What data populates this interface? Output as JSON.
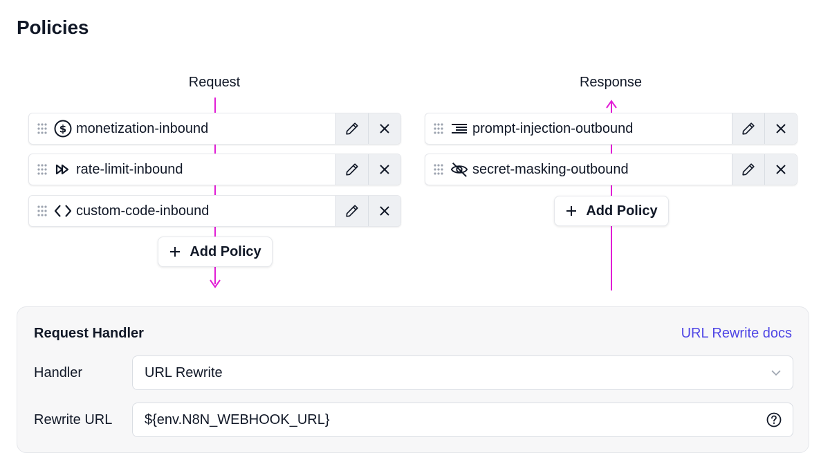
{
  "page": {
    "title": "Policies"
  },
  "request": {
    "label": "Request",
    "policies": [
      {
        "name": "monetization-inbound",
        "icon": "dollar-circle-icon"
      },
      {
        "name": "rate-limit-inbound",
        "icon": "fast-forward-icon"
      },
      {
        "name": "custom-code-inbound",
        "icon": "code-brackets-icon"
      }
    ],
    "add_label": "Add Policy"
  },
  "response": {
    "label": "Response",
    "policies": [
      {
        "name": "prompt-injection-outbound",
        "icon": "text-align-icon"
      },
      {
        "name": "secret-masking-outbound",
        "icon": "eye-off-icon"
      }
    ],
    "add_label": "Add Policy"
  },
  "handler": {
    "title": "Request Handler",
    "docs_link": "URL Rewrite docs",
    "handler_label": "Handler",
    "handler_value": "URL Rewrite",
    "rewrite_label": "Rewrite URL",
    "rewrite_value": "${env.N8N_WEBHOOK_URL}"
  },
  "colors": {
    "flow_line": "#e11dd5",
    "link": "#4f46e5",
    "button_bg": "#eef0f3",
    "panel_bg": "#f7f7f8"
  }
}
